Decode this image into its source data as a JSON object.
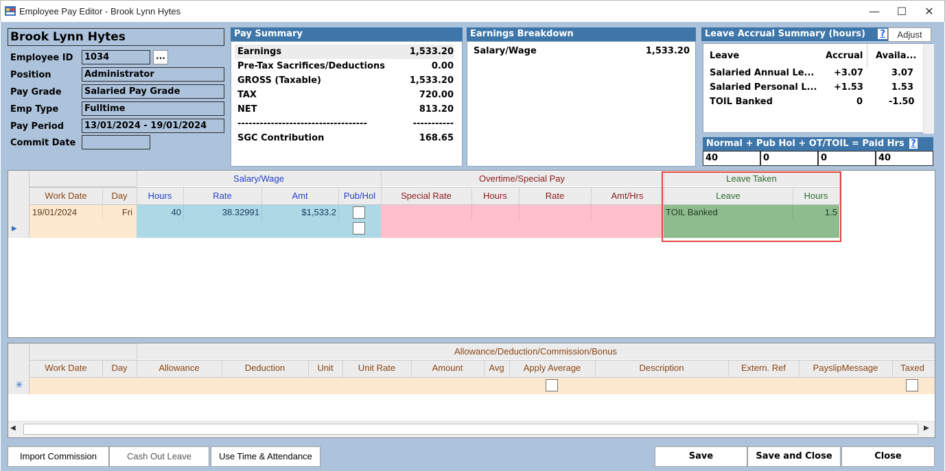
{
  "window": {
    "title": "Employee Pay Editor - Brook Lynn Hytes",
    "minimize": "—",
    "maximize": "☐",
    "close": "✕"
  },
  "employee": {
    "name": "Brook Lynn Hytes",
    "fields": [
      {
        "label": "Employee ID",
        "value": "1034"
      },
      {
        "label": "Position",
        "value": "Administrator"
      },
      {
        "label": "Pay Grade",
        "value": "Salaried Pay Grade"
      },
      {
        "label": "Emp Type",
        "value": "Fulltime"
      },
      {
        "label": "Pay Period",
        "value": "13/01/2024 - 19/01/2024"
      },
      {
        "label": "Commit Date",
        "value": ""
      }
    ],
    "lookup_button": "..."
  },
  "pay_summary": {
    "header": "Pay Summary",
    "rows": [
      {
        "label": "Earnings",
        "value": "1,533.20"
      },
      {
        "label": "Pre-Tax Sacrifices/Deductions",
        "value": "0.00"
      },
      {
        "label": "GROSS (Taxable)",
        "value": "1,533.20"
      },
      {
        "label": "TAX",
        "value": "720.00"
      },
      {
        "label": "NET",
        "value": "813.20"
      },
      {
        "label": "-----------------------------------",
        "value": "-----------"
      },
      {
        "label": "SGC Contribution",
        "value": "168.65"
      }
    ]
  },
  "earnings_breakdown": {
    "header": "Earnings Breakdown",
    "rows": [
      {
        "label": "Salary/Wage",
        "value": "1,533.20"
      }
    ]
  },
  "leave_accrual": {
    "header": "Leave Accrual Summary (hours)",
    "help": "?",
    "adjust_button": "Adjust",
    "columns": [
      "Leave",
      "Accrual",
      "Availa..."
    ],
    "rows": [
      {
        "leave": "Salaried Annual Le...",
        "accrual": "+3.07",
        "available": "3.07"
      },
      {
        "leave": "Salaried Personal L...",
        "accrual": "+1.53",
        "available": "1.53"
      },
      {
        "leave": "TOIL Banked",
        "accrual": "0",
        "available": "-1.50"
      }
    ]
  },
  "hours_summary": {
    "header": "Normal  + Pub Hol  +  OT/TOIL  = Paid Hrs",
    "help": "?",
    "values": [
      "40",
      "0",
      "0",
      "40"
    ]
  },
  "pay_grid": {
    "groups": {
      "salary": "Salary/Wage",
      "overtime": "Overtime/Special Pay",
      "leave": "Leave Taken"
    },
    "columns": {
      "work_date": "Work Date",
      "day": "Day",
      "hours": "Hours",
      "rate": "Rate",
      "amt": "Amt",
      "pub_hol": "Pub/Hol",
      "special_rate": "Special Rate",
      "ot_hours": "Hours",
      "ot_rate": "Rate",
      "amt_hrs": "Amt/Hrs",
      "leave": "Leave",
      "leave_hours": "Hours"
    },
    "row": {
      "work_date": "19/01/2024",
      "day": "Fri",
      "hours": "40",
      "rate": "38.32991",
      "amt": "$1,533.2",
      "leave": "TOIL Banked",
      "leave_hours": "1.5"
    }
  },
  "allowance_grid": {
    "group": "Allowance/Deduction/Commission/Bonus",
    "columns": [
      "Work Date",
      "Day",
      "Allowance",
      "Deduction",
      "Unit",
      "Unit Rate",
      "Amount",
      "Avg",
      "Apply Average",
      "Description",
      "Extern. Ref",
      "PayslipMessage",
      "Taxed"
    ],
    "new_row_marker": "✳"
  },
  "buttons": {
    "import_commission": "Import Commission",
    "cash_out_leave": "Cash Out Leave",
    "use_time_attendance": "Use Time & Attendance",
    "save": "Save",
    "save_close": "Save and Close",
    "close": "Close"
  },
  "colors": {
    "panel_header": "#3e76aa",
    "client_bg": "#adc3dc",
    "salary_cell": "#add8e6",
    "overtime_cell": "#ffc0cb",
    "leave_cell": "#8fbc8f",
    "workdate_cell": "#fde9d0",
    "highlight_border": "#e0443c"
  }
}
